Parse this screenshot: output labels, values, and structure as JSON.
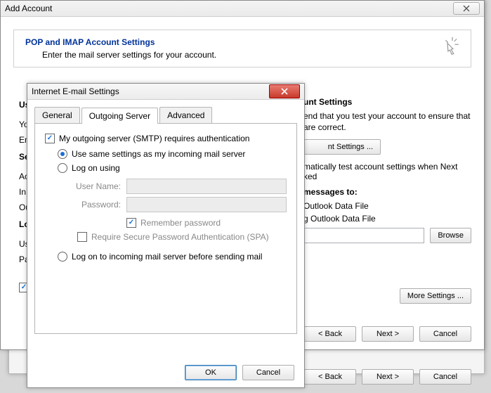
{
  "main": {
    "title": "Add Account",
    "header": {
      "heading": "POP and IMAP Account Settings",
      "sub": "Enter the mail server settings for your account."
    },
    "left_labels": {
      "user_info": "User Information",
      "your": "Yo",
      "email": "Em",
      "server_info": "Se",
      "account_type": "Ac",
      "incoming": "In",
      "outgoing": "Ou",
      "logon_info": "Lo",
      "user_name": "Us",
      "password": "Pa"
    },
    "right": {
      "heading": "Test Account Settings",
      "desc1": "end that you test your account to ensure that",
      "desc2": "are correct.",
      "test_btn": "nt Settings ...",
      "auto_test": "matically test account settings when Next",
      "auto_test2": "ked",
      "deliver_heading": "messages to:",
      "deliver_opt1": "Outlook Data File",
      "deliver_opt2": "g Outlook Data File",
      "browse": "Browse",
      "more": "More Settings ..."
    },
    "footer": {
      "back": "< Back",
      "next": "Next >",
      "cancel": "Cancel"
    }
  },
  "dialog": {
    "title": "Internet E-mail Settings",
    "tabs": {
      "general": "General",
      "outgoing": "Outgoing Server",
      "advanced": "Advanced"
    },
    "smtp_auth": "My outgoing server (SMTP) requires authentication",
    "use_same": "Use same settings as my incoming mail server",
    "log_on_using": "Log on using",
    "user_name_label": "User Name:",
    "password_label": "Password:",
    "remember": "Remember password",
    "spa": "Require Secure Password Authentication (SPA)",
    "logon_incoming": "Log on to incoming mail server before sending mail",
    "ok": "OK",
    "cancel": "Cancel"
  }
}
